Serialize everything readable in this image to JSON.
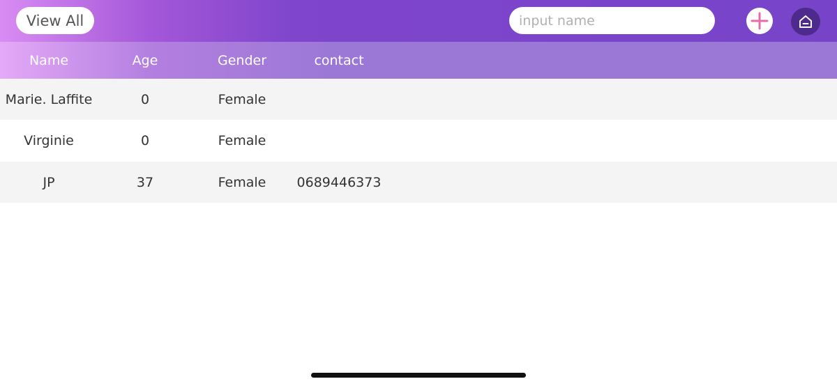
{
  "toolbar": {
    "view_all_label": "View All",
    "search_placeholder": "input name",
    "search_value": "",
    "add_icon": "plus-icon",
    "home_icon": "home-icon"
  },
  "colors": {
    "topbar_gradient_start": "#d98cf3",
    "topbar_gradient_end": "#7744c9",
    "header_gradient_start": "#e4a9f7",
    "header_gradient_end": "#9b78d6",
    "plus_icon": "#e96aa9",
    "home_button_bg": "#4d2a8c"
  },
  "table": {
    "columns": [
      "Name",
      "Age",
      "Gender",
      "contact"
    ],
    "rows": [
      {
        "name": "Marie. Laffite",
        "age": "0",
        "gender": "Female",
        "contact": ""
      },
      {
        "name": "Virginie",
        "age": "0",
        "gender": "Female",
        "contact": ""
      },
      {
        "name": "JP",
        "age": "37",
        "gender": "Female",
        "contact": "0689446373"
      }
    ]
  }
}
